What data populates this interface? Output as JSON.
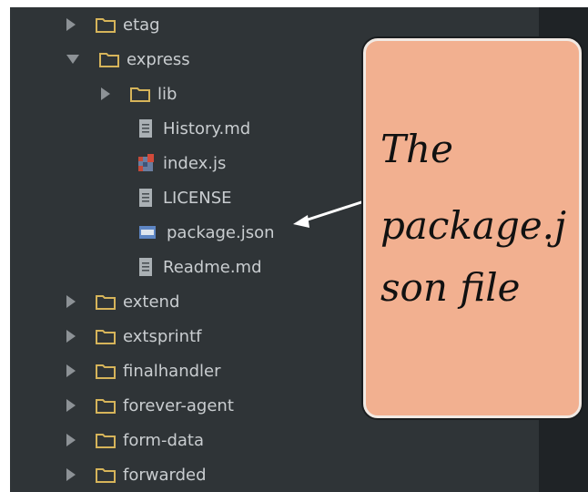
{
  "tree": {
    "items": [
      {
        "label": "etag"
      },
      {
        "label": "express"
      },
      {
        "label": "lib"
      },
      {
        "label": "History.md"
      },
      {
        "label": "index.js"
      },
      {
        "label": "LICENSE"
      },
      {
        "label": "package.json"
      },
      {
        "label": "Readme.md"
      },
      {
        "label": "extend"
      },
      {
        "label": "extsprintf"
      },
      {
        "label": "finalhandler"
      },
      {
        "label": "forever-agent"
      },
      {
        "label": "form-data"
      },
      {
        "label": "forwarded"
      }
    ]
  },
  "callout": {
    "lines": [
      "The",
      "package.j",
      "son file"
    ]
  },
  "icons": {
    "folder": "folder-icon",
    "markdown": "document-icon",
    "javascript": "js-file-icon",
    "license": "document-icon",
    "json": "json-file-icon"
  },
  "colors": {
    "panel_bg": "#2f3437",
    "text": "#c9cdd0",
    "folder": "#d6b45a",
    "callout_bg": "#f2b090",
    "arrow": "#ffffff"
  }
}
